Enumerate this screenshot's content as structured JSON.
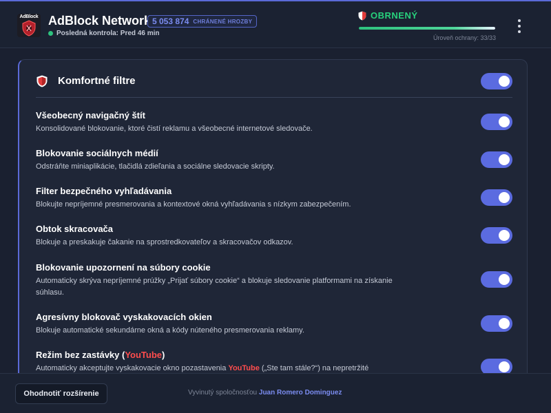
{
  "header": {
    "logo_text": "AdBlock",
    "app_title": "AdBlock Network",
    "threat_count": "5 053 874",
    "threat_label": "CHRÁNENÉ HROZBY",
    "last_check": "Posledná kontrola: Pred 46 min",
    "protected_label": "OBRNENÝ",
    "protection_level": "Úroveň ochrany: 33/33",
    "protection_fraction": 1.0,
    "accent_color": "#5b6ad8",
    "status_color": "#27d17c"
  },
  "card": {
    "title": "Komfortné filtre",
    "enabled": true,
    "filters": [
      {
        "title": "Všeobecný navigačný štít",
        "description": "Konsolidované blokovanie, ktoré čistí reklamu a všeobecné internetové sledovače.",
        "enabled": true
      },
      {
        "title": "Blokovanie sociálnych médií",
        "description": "Odstráňte miniaplikácie, tlačidlá zdieľania a sociálne sledovacie skripty.",
        "enabled": true
      },
      {
        "title": "Filter bezpečného vyhľadávania",
        "description": "Blokujte nepríjemné presmerovania a kontextové okná vyhľadávania s nízkym zabezpečením.",
        "enabled": true
      },
      {
        "title": "Obtok skracovača",
        "description": "Blokuje a preskakuje čakanie na sprostredkovateľov a skracovačov odkazov.",
        "enabled": true
      },
      {
        "title": "Blokovanie upozornení na súbory cookie",
        "description": "Automaticky skrýva nepríjemné prúžky „Prijať súbory cookie“ a blokuje sledovanie platformami na získanie súhlasu.",
        "enabled": true
      },
      {
        "title": "Agresívny blokovač vyskakovacích okien",
        "description": "Blokuje automatické sekundárne okná a kódy núteného presmerovania reklamy.",
        "enabled": true
      },
      {
        "title_prefix": "Režim bez zastávky (",
        "title_brand": "YouTube",
        "title_suffix": ")",
        "desc_prefix": "Automaticky akceptujte vyskakovacie okno pozastavenia ",
        "desc_brand": "YouTube",
        "desc_suffix": " („Ste tam stále?“) na nepretržité",
        "enabled": true
      }
    ]
  },
  "footer": {
    "report_button": "Ohodnotiť rozšírenie",
    "credit_prefix": "Vyvinutý spoločnosťou ",
    "credit_author": "Juan Romero Dominguez"
  },
  "icons": [
    "shield-icon",
    "kebab-menu-icon",
    "status-dot-icon"
  ]
}
